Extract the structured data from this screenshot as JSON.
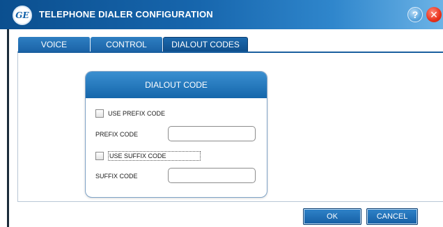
{
  "window": {
    "title": "TELEPHONE DIALER CONFIGURATION",
    "logo_text": "GE",
    "help_label": "?",
    "close_label": "✕"
  },
  "tabs": [
    {
      "label": "VOICE",
      "active": false
    },
    {
      "label": "CONTROL",
      "active": false
    },
    {
      "label": "DIALOUT CODES",
      "active": true
    }
  ],
  "panel": {
    "title": "DIALOUT CODE",
    "use_prefix": {
      "label": "USE PREFIX CODE",
      "checked": false
    },
    "prefix": {
      "label": "PREFIX CODE",
      "value": ""
    },
    "use_suffix": {
      "label": "USE SUFFIX CODE",
      "checked": false
    },
    "suffix": {
      "label": "SUFFIX CODE",
      "value": ""
    }
  },
  "footer": {
    "ok_label": "OK",
    "cancel_label": "CANCEL"
  },
  "colors": {
    "accent": "#1566ab",
    "title_bar_start": "#0b4f8f",
    "title_bar_end": "#6cb3e6",
    "close": "#e8311b"
  }
}
